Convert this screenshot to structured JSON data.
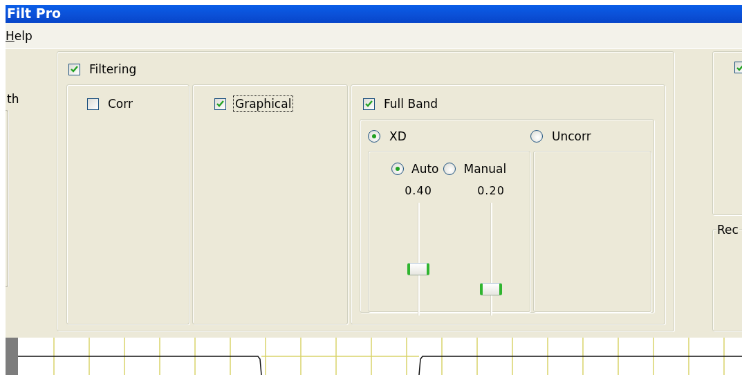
{
  "window": {
    "title": "Filt Pro"
  },
  "menu": [
    {
      "label": "Help"
    }
  ],
  "left_panel": {
    "label": "th"
  },
  "filtering": {
    "label": "Filtering",
    "checked": true,
    "corr": {
      "label": "Corr",
      "checked": false
    },
    "graphical": {
      "label": "Graphical",
      "checked": true,
      "focused": true
    },
    "full_band": {
      "label": "Full Band",
      "checked": true,
      "modes": [
        {
          "label": "XD",
          "selected": true
        },
        {
          "label": "Uncorr",
          "selected": false
        }
      ],
      "xd": {
        "options": [
          {
            "label": "Auto",
            "selected": true
          },
          {
            "label": "Manual",
            "selected": false
          }
        ],
        "sliders": [
          {
            "reading": "0.40",
            "level": 0.4
          },
          {
            "reading": "0.20",
            "level": 0.2
          }
        ]
      }
    }
  },
  "right_panel": {
    "checked": true,
    "group_label": "Rec"
  }
}
